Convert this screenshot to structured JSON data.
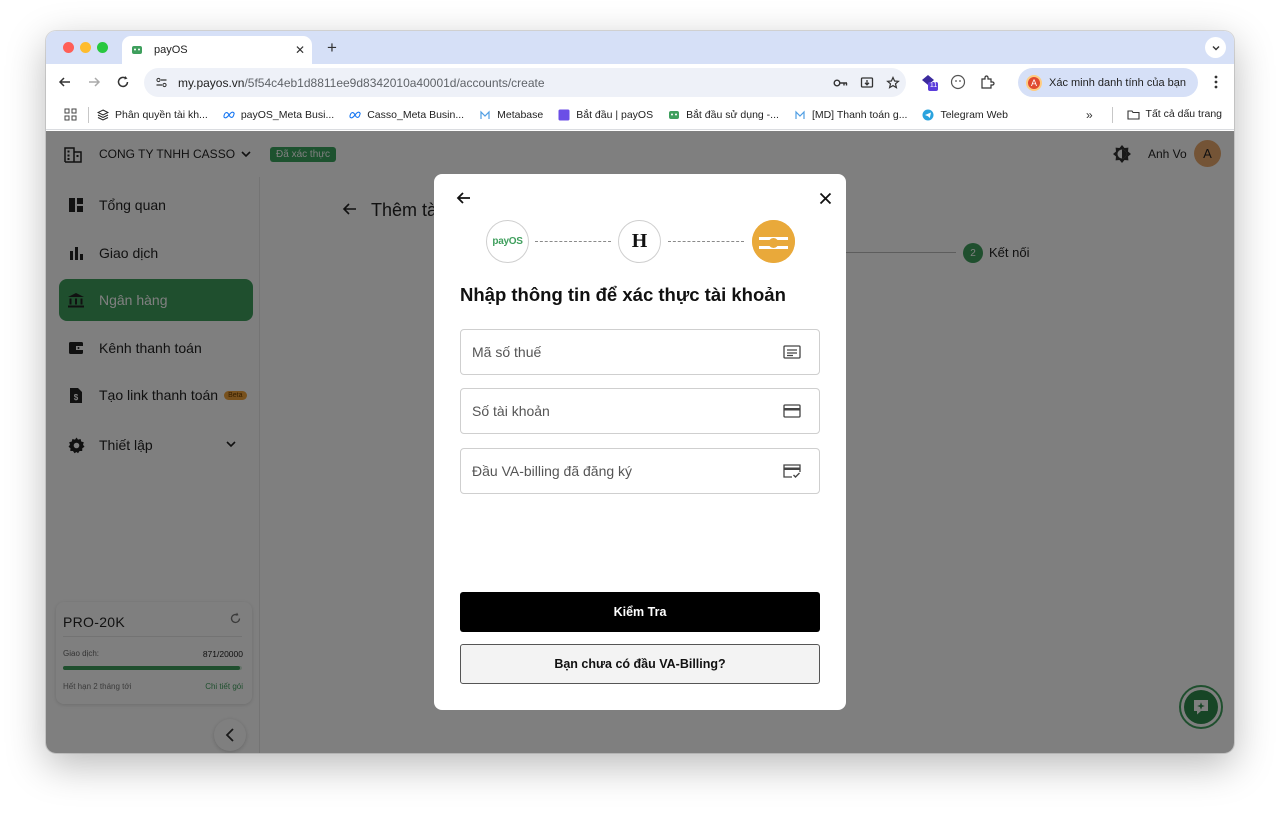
{
  "browser": {
    "tab_title": "payOS",
    "tab_close": "✕",
    "new_tab": "+",
    "url_host": "my.payos.vn",
    "url_path": "/5f54c4eb1d8811ee9d8342010a40001d/accounts/create",
    "profile_text": "Xác minh danh tính của bạn",
    "profile_initial": "A",
    "ext_badge": "11"
  },
  "bookmarks": {
    "items": [
      {
        "label": "Phân quyền tài kh...",
        "icon": "stack-icon"
      },
      {
        "label": "payOS_Meta Busi...",
        "icon": "meta-icon"
      },
      {
        "label": "Casso_Meta Busin...",
        "icon": "meta-icon"
      },
      {
        "label": "Metabase",
        "icon": "metabase-icon"
      },
      {
        "label": "Bắt đầu | payOS",
        "icon": "purple-square-icon"
      },
      {
        "label": "Bắt đầu sử dụng -...",
        "icon": "payos-icon"
      },
      {
        "label": "[MD] Thanh toán g...",
        "icon": "metabase-icon"
      },
      {
        "label": "Telegram Web",
        "icon": "telegram-icon"
      }
    ],
    "more": "»",
    "all_label": "Tất cả dấu trang"
  },
  "appbar": {
    "company": "CONG TY TNHH CASSO",
    "verified": "Đã xác thực",
    "user_name": "Anh Vo",
    "user_initial": "A"
  },
  "sidebar": {
    "items": [
      {
        "label": "Tổng quan"
      },
      {
        "label": "Giao dịch"
      },
      {
        "label": "Ngân hàng"
      },
      {
        "label": "Kênh thanh toán"
      },
      {
        "label": "Tạo link thanh toán",
        "badge": "Beta"
      },
      {
        "label": "Thiết lập"
      }
    ],
    "active_index": 2
  },
  "plan": {
    "name": "PRO-20K",
    "tx_label": "Giao dịch:",
    "tx_value": "871/20000",
    "tx_progress": 0.99,
    "expire": "Hết hạn 2 tháng tới",
    "detail_link": "Chi tiết gói"
  },
  "content": {
    "title": "Thêm tài",
    "step_number": "2",
    "step_label": "Kết nối"
  },
  "modal": {
    "payos_logo_text": "payOS",
    "h_logo_text": "H",
    "title": "Nhập thông tin để xác thực tài khoản",
    "fields": [
      {
        "placeholder": "Mã số thuế",
        "value": ""
      },
      {
        "placeholder": "Số tài khoản",
        "value": ""
      },
      {
        "placeholder": "Đầu VA-billing đã đăng ký",
        "value": ""
      }
    ],
    "primary_button": "Kiểm Tra",
    "secondary_button": "Bạn chưa có đầu VA-Billing?"
  },
  "colors": {
    "brand_green": "#3f9f5d",
    "bank_gold": "#e9a93a",
    "primary_button": "#000000"
  }
}
